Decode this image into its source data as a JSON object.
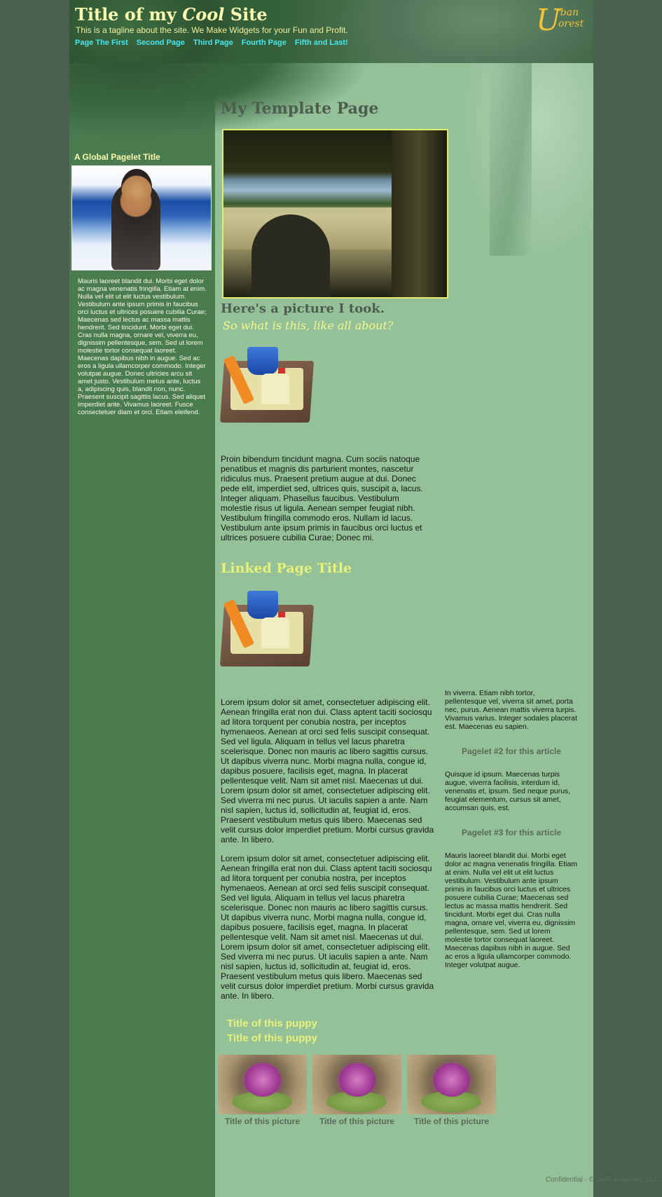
{
  "header": {
    "title_prefix": "Title of my ",
    "title_italic": "Cool",
    "title_suffix": " Site",
    "tagline": "This is a tagline about the site. We Make Widgets for your Fun and Profit.",
    "logo_letter": "U",
    "logo_word_1": "rban",
    "logo_word_2": "orest"
  },
  "nav": [
    {
      "label": "Page The First"
    },
    {
      "label": "Second Page"
    },
    {
      "label": "Third Page"
    },
    {
      "label": "Fourth Page"
    },
    {
      "label": "Fifth and Last!"
    }
  ],
  "sidebar": {
    "pagelet_title": "A Global Pagelet Title",
    "pagelet_text": "Mauris laoreet blandit dui. Morbi eget dolor ac magna venenatis fringilla. Etiam at enim. Nulla vel elit ut elit luctus vestibulum. Vestibulum ante ipsum primis in faucibus orci luctus et ultrices posuere cubilia Curae; Maecenas sed lectus ac massa mattis hendrerit. Sed tincidunt. Morbi eget dui. Cras nulla magna, ornare vel, viverra eu, dignissim pellentesque, sem. Sed ut lorem molestie tortor consequat laoreet. Maecenas dapibus nibh in augue. Sed ac eros a ligula ullamcorper commodo. Integer volutpat augue. Donec ultricies arcu sit amet justo. Vestibulum metus ante, luctus a, adipiscing quis, blandit non, nunc. Praesent suscipit sagittis lacus. Sed aliquet imperdiet ante. Vivamus laoreet. Fusce consectetuer diam et orci. Etiam eleifend."
  },
  "main": {
    "page_title": "My Template Page",
    "photo_caption": "Here's a picture I took.",
    "photo_subcaption": "So what is this, like all about?",
    "body_text_1": "Proin bibendum tincidunt magna. Cum sociis natoque penatibus et magnis dis parturient montes, nascetur ridiculus mus. Praesent pretium augue at dui. Donec pede elit, imperdiet sed, ultrices quis, suscipit a, lacus. Integer aliquam. Phasellus faucibus. Vestibulum molestie risus ut ligula. Aenean semper feugiat nibh. Vestibulum fringilla commodo eros. Nullam id lacus. Vestibulum ante ipsum primis in faucibus orci luctus et ultrices posuere cubilia Curae; Donec mi.",
    "linked_title": "Linked Page Title",
    "body_text_2": "Lorem ipsum dolor sit amet, consectetuer adipiscing elit. Aenean fringilla erat non dui. Class aptent taciti sociosqu ad litora torquent per conubia nostra, per inceptos hymenaeos. Aenean at orci sed felis suscipit consequat. Sed vel ligula. Aliquam in tellus vel lacus pharetra scelerisque. Donec non mauris ac libero sagittis cursus. Ut dapibus viverra nunc. Morbi magna nulla, congue id, dapibus posuere, facilisis eget, magna. In placerat pellentesque velit. Nam sit amet nisl. Maecenas ut dui. Lorem ipsum dolor sit amet, consectetuer adipiscing elit. Sed viverra mi nec purus. Ut iaculis sapien a ante. Nam nisl sapien, luctus id, sollicitudin at, feugiat id, eros. Praesent vestibulum metus quis libero. Maecenas sed velit cursus dolor imperdiet pretium. Morbi cursus gravida ante. In libero.",
    "body_text_3": "Lorem ipsum dolor sit amet, consectetuer adipiscing elit. Aenean fringilla erat non dui. Class aptent taciti sociosqu ad litora torquent per conubia nostra, per inceptos hymenaeos. Aenean at orci sed felis suscipit consequat. Sed vel ligula. Aliquam in tellus vel lacus pharetra scelerisque. Donec non mauris ac libero sagittis cursus. Ut dapibus viverra nunc. Morbi magna nulla, congue id, dapibus posuere, facilisis eget, magna. In placerat pellentesque velit. Nam sit amet nisl. Maecenas ut dui. Lorem ipsum dolor sit amet, consectetuer adipiscing elit. Sed viverra mi nec purus. Ut iaculis sapien a ante. Nam nisl sapien, luctus id, sollicitudin at, feugiat id, eros. Praesent vestibulum metus quis libero. Maecenas sed velit cursus dolor imperdiet pretium. Morbi cursus gravida ante. In libero.",
    "puppy_title_1": "Title of this puppy",
    "puppy_title_2": "Title of this puppy"
  },
  "article_pagelets": {
    "pagelet_1_text": "In viverra. Etiam nibh tortor, pellentesque vel, viverra sit amet, porta nec, purus. Aenean mattis viverra turpis. Vivamus varius. Integer sodales placerat est. Maecenas eu sapien.",
    "pagelet_2_title": "Pagelet #2 for this article",
    "pagelet_2_text": "Quisque id ipsum. Maecenas turpis augue, viverra facilisis, interdum id, venenatis et, ipsum. Sed neque purus, feugiat elementum, cursus sit amet, accumsan quis, est.",
    "pagelet_3_title": "Pagelet #3 for this article",
    "pagelet_3_text": "Mauris laoreet blandit dui. Morbi eget dolor ac magna venenatis fringilla. Etiam at enim. Nulla vel elit ut elit luctus vestibulum. Vestibulum ante ipsum primis in faucibus orci luctus et ultrices posuere cubilia Curae; Maecenas sed lectus ac massa mattis hendrerit. Sed tincidunt. Morbi eget dui. Cras nulla magna, ornare vel, viverra eu, dignissim pellentesque, sem. Sed ut lorem molestie tortor consequat laoreet. Maecenas dapibus nibh in augue. Sed ac eros a ligula ullamcorper commodo. Integer volutpat augue."
  },
  "gallery": [
    {
      "caption": "Title of this picture"
    },
    {
      "caption": "Title of this picture"
    },
    {
      "caption": "Title of this picture"
    }
  ],
  "footer": {
    "text": "Confidential · © 2005 Biophony, LLC."
  }
}
